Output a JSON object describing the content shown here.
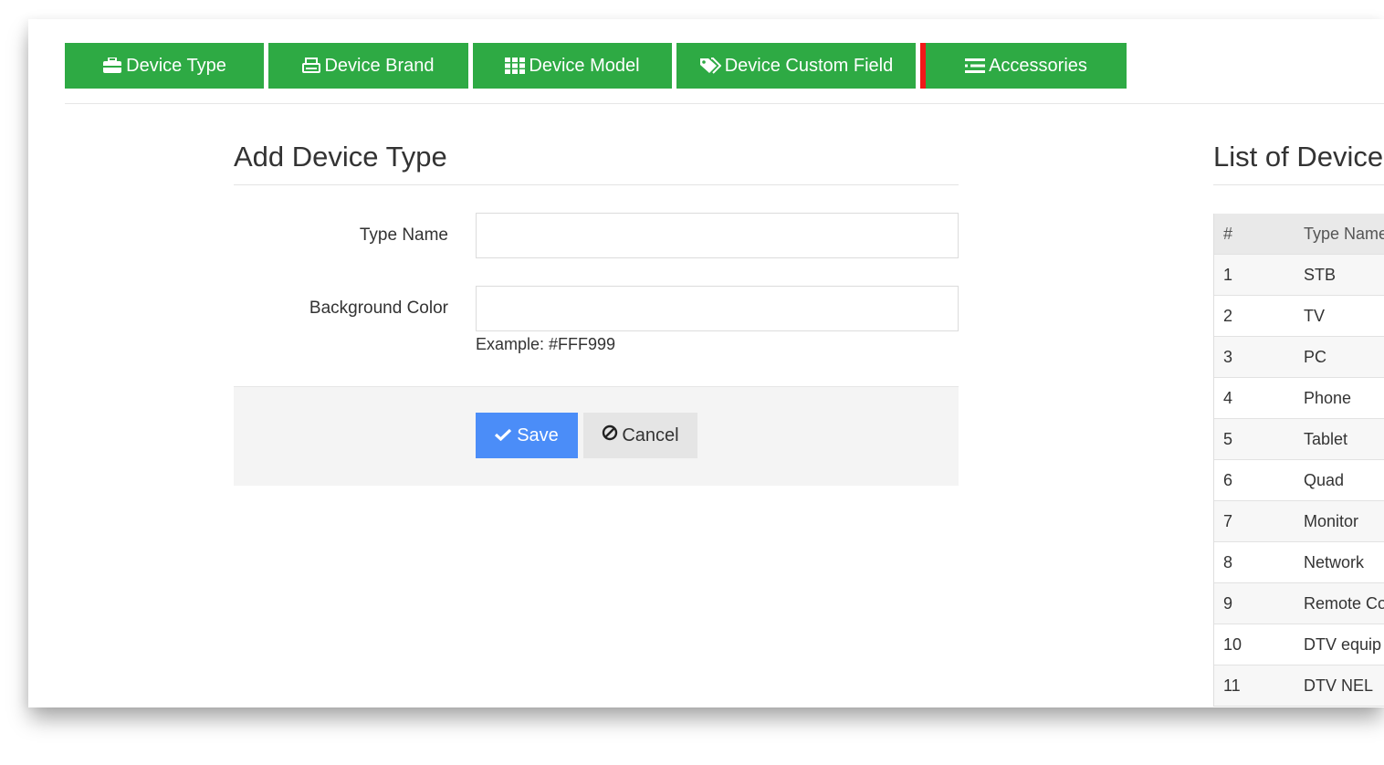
{
  "tabs": [
    {
      "label": "Device Type",
      "icon": "briefcase-icon"
    },
    {
      "label": "Device Brand",
      "icon": "print-icon"
    },
    {
      "label": "Device Model",
      "icon": "grid-icon"
    },
    {
      "label": "Device Custom Field",
      "icon": "tags-icon"
    },
    {
      "label": "Accessories",
      "icon": "list-icon"
    }
  ],
  "form": {
    "title": "Add Device Type",
    "type_name_label": "Type Name",
    "type_name_value": "",
    "background_color_label": "Background Color",
    "background_color_value": "",
    "hint": "Example: #FFF999",
    "save_label": "Save",
    "cancel_label": "Cancel"
  },
  "list": {
    "title": "List of Device",
    "columns": [
      "#",
      "Type Name"
    ],
    "rows": [
      {
        "num": "1",
        "name": "STB"
      },
      {
        "num": "2",
        "name": "TV"
      },
      {
        "num": "3",
        "name": "PC"
      },
      {
        "num": "4",
        "name": "Phone"
      },
      {
        "num": "5",
        "name": "Tablet"
      },
      {
        "num": "6",
        "name": "Quad"
      },
      {
        "num": "7",
        "name": "Monitor"
      },
      {
        "num": "8",
        "name": "Network"
      },
      {
        "num": "9",
        "name": "Remote Co"
      },
      {
        "num": "10",
        "name": "DTV equip"
      },
      {
        "num": "11",
        "name": "DTV NEL"
      }
    ]
  },
  "colors": {
    "tab_green": "#2eaa44",
    "active_marker": "#f01919",
    "save_blue": "#4b8df8"
  }
}
